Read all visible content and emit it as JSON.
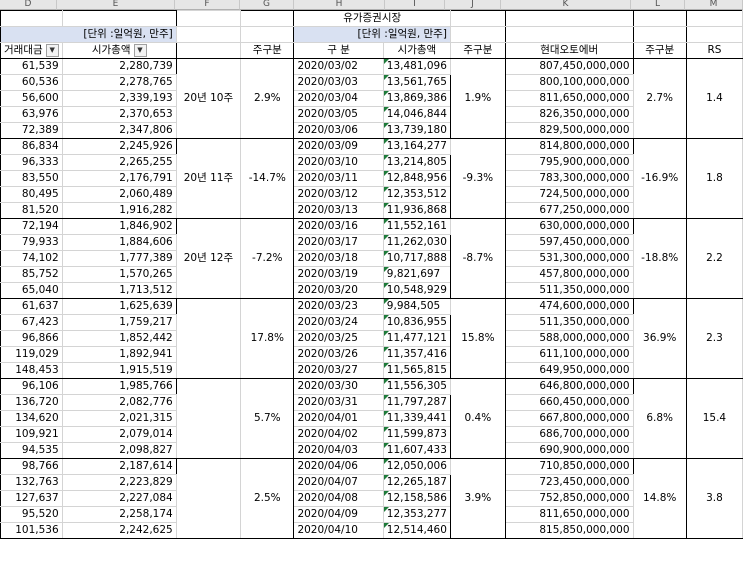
{
  "column_letters": [
    "D",
    "E",
    "F",
    "G",
    "H",
    "I",
    "J",
    "K",
    "L",
    "M"
  ],
  "header": {
    "market_title": "유가증권시장",
    "unit_left": "[단위 :일억원, 만주]",
    "unit_right": "[단위 :일억원, 만주]",
    "col_trade": "거래대금",
    "col_mktcap": "시가총액",
    "col_week_chg": "주구분",
    "col_period": "구 분",
    "col_mktcap2": "시가총액",
    "col_week_chg2": "주구분",
    "col_hyundai": "현대오토에버",
    "col_week_chg3": "주구분",
    "col_rs": "RS"
  },
  "filter_icon": "dropdown-filter-icon",
  "weeks": [
    {
      "label": "20년 10주",
      "g": "2.9%",
      "j": "1.9%",
      "l": "2.7%",
      "rs": "1.4",
      "rows": [
        {
          "d": "61,539",
          "e": "2,280,739",
          "date": "2020/03/02",
          "i": "13,481,096",
          "k": "807,450,000,000"
        },
        {
          "d": "60,536",
          "e": "2,278,765",
          "date": "2020/03/03",
          "i": "13,561,765",
          "k": "800,100,000,000"
        },
        {
          "d": "56,600",
          "e": "2,339,193",
          "date": "2020/03/04",
          "i": "13,869,386",
          "k": "811,650,000,000"
        },
        {
          "d": "63,976",
          "e": "2,370,653",
          "date": "2020/03/05",
          "i": "14,046,844",
          "k": "826,350,000,000"
        },
        {
          "d": "72,389",
          "e": "2,347,806",
          "date": "2020/03/06",
          "i": "13,739,180",
          "k": "829,500,000,000"
        }
      ]
    },
    {
      "label": "20년 11주",
      "g": "-14.7%",
      "j": "-9.3%",
      "l": "-16.9%",
      "rs": "1.8",
      "rows": [
        {
          "d": "86,834",
          "e": "2,245,926",
          "date": "2020/03/09",
          "i": "13,164,277",
          "k": "814,800,000,000"
        },
        {
          "d": "96,333",
          "e": "2,265,255",
          "date": "2020/03/10",
          "i": "13,214,805",
          "k": "795,900,000,000"
        },
        {
          "d": "83,550",
          "e": "2,176,791",
          "date": "2020/03/11",
          "i": "12,848,956",
          "k": "783,300,000,000"
        },
        {
          "d": "80,495",
          "e": "2,060,489",
          "date": "2020/03/12",
          "i": "12,353,512",
          "k": "724,500,000,000"
        },
        {
          "d": "81,520",
          "e": "1,916,282",
          "date": "2020/03/13",
          "i": "11,936,868",
          "k": "677,250,000,000"
        }
      ]
    },
    {
      "label": "20년 12주",
      "g": "-7.2%",
      "j": "-8.7%",
      "l": "-18.8%",
      "rs": "2.2",
      "rows": [
        {
          "d": "72,194",
          "e": "1,846,902",
          "date": "2020/03/16",
          "i": "11,552,161",
          "k": "630,000,000,000"
        },
        {
          "d": "79,933",
          "e": "1,884,606",
          "date": "2020/03/17",
          "i": "11,262,030",
          "k": "597,450,000,000"
        },
        {
          "d": "74,102",
          "e": "1,777,389",
          "date": "2020/03/18",
          "i": "10,717,888",
          "k": "531,300,000,000"
        },
        {
          "d": "85,752",
          "e": "1,570,265",
          "date": "2020/03/19",
          "i": "9,821,697",
          "k": "457,800,000,000"
        },
        {
          "d": "65,040",
          "e": "1,713,512",
          "date": "2020/03/20",
          "i": "10,548,929",
          "k": "511,350,000,000"
        }
      ]
    },
    {
      "label": "",
      "g": "17.8%",
      "j": "15.8%",
      "l": "36.9%",
      "rs": "2.3",
      "rows": [
        {
          "d": "61,637",
          "e": "1,625,639",
          "date": "2020/03/23",
          "i": "9,984,505",
          "k": "474,600,000,000"
        },
        {
          "d": "67,423",
          "e": "1,759,217",
          "date": "2020/03/24",
          "i": "10,836,955",
          "k": "511,350,000,000"
        },
        {
          "d": "96,866",
          "e": "1,852,442",
          "date": "2020/03/25",
          "i": "11,477,121",
          "k": "588,000,000,000"
        },
        {
          "d": "119,029",
          "e": "1,892,941",
          "date": "2020/03/26",
          "i": "11,357,416",
          "k": "611,100,000,000"
        },
        {
          "d": "148,453",
          "e": "1,915,519",
          "date": "2020/03/27",
          "i": "11,565,815",
          "k": "649,950,000,000"
        }
      ]
    },
    {
      "label": "",
      "g": "5.7%",
      "j": "0.4%",
      "l": "6.8%",
      "rs": "15.4",
      "rows": [
        {
          "d": "96,106",
          "e": "1,985,766",
          "date": "2020/03/30",
          "i": "11,556,305",
          "k": "646,800,000,000"
        },
        {
          "d": "136,720",
          "e": "2,082,776",
          "date": "2020/03/31",
          "i": "11,797,287",
          "k": "660,450,000,000"
        },
        {
          "d": "134,620",
          "e": "2,021,315",
          "date": "2020/04/01",
          "i": "11,339,441",
          "k": "667,800,000,000"
        },
        {
          "d": "109,921",
          "e": "2,079,014",
          "date": "2020/04/02",
          "i": "11,599,873",
          "k": "686,700,000,000"
        },
        {
          "d": "94,535",
          "e": "2,098,827",
          "date": "2020/04/03",
          "i": "11,607,433",
          "k": "690,900,000,000"
        }
      ]
    },
    {
      "label": "",
      "g": "2.5%",
      "j": "3.9%",
      "l": "14.8%",
      "rs": "3.8",
      "rows": [
        {
          "d": "98,766",
          "e": "2,187,614",
          "date": "2020/04/06",
          "i": "12,050,006",
          "k": "710,850,000,000"
        },
        {
          "d": "132,763",
          "e": "2,223,829",
          "date": "2020/04/07",
          "i": "12,265,187",
          "k": "723,450,000,000"
        },
        {
          "d": "127,637",
          "e": "2,227,084",
          "date": "2020/04/08",
          "i": "12,158,586",
          "k": "752,850,000,000"
        },
        {
          "d": "95,520",
          "e": "2,258,174",
          "date": "2020/04/09",
          "i": "12,353,277",
          "k": "811,650,000,000"
        },
        {
          "d": "101,536",
          "e": "2,242,625",
          "date": "2020/04/10",
          "i": "12,514,460",
          "k": "815,850,000,000"
        }
      ]
    }
  ]
}
